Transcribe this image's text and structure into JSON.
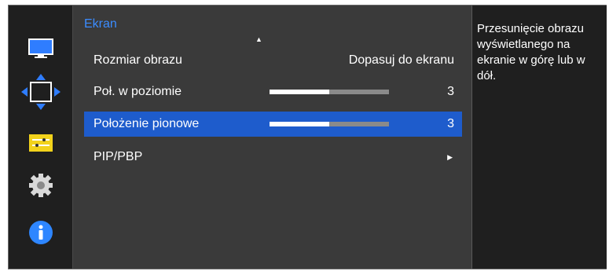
{
  "menu": {
    "section_title": "Ekran",
    "rail_icons": [
      "monitor-icon",
      "move-arrows-icon",
      "settings-list-icon",
      "gear-icon",
      "info-icon"
    ],
    "rows": [
      {
        "label": "Rozmiar obrazu",
        "value": "Dopasuj do ekranu"
      },
      {
        "label": "Poł. w poziomie",
        "value": "3",
        "level_percent": 50
      },
      {
        "label": "Położenie pionowe",
        "value": "3",
        "level_percent": 50
      },
      {
        "label": "PIP/PBP"
      }
    ]
  },
  "help": {
    "text": "Przesunięcie obrazu wyświetlanego na ekranie w górę lub w dół."
  },
  "colors": {
    "accent": "#3b8cff",
    "selected_row": "#1e5ccc",
    "info_icon": "#2e86ff"
  }
}
